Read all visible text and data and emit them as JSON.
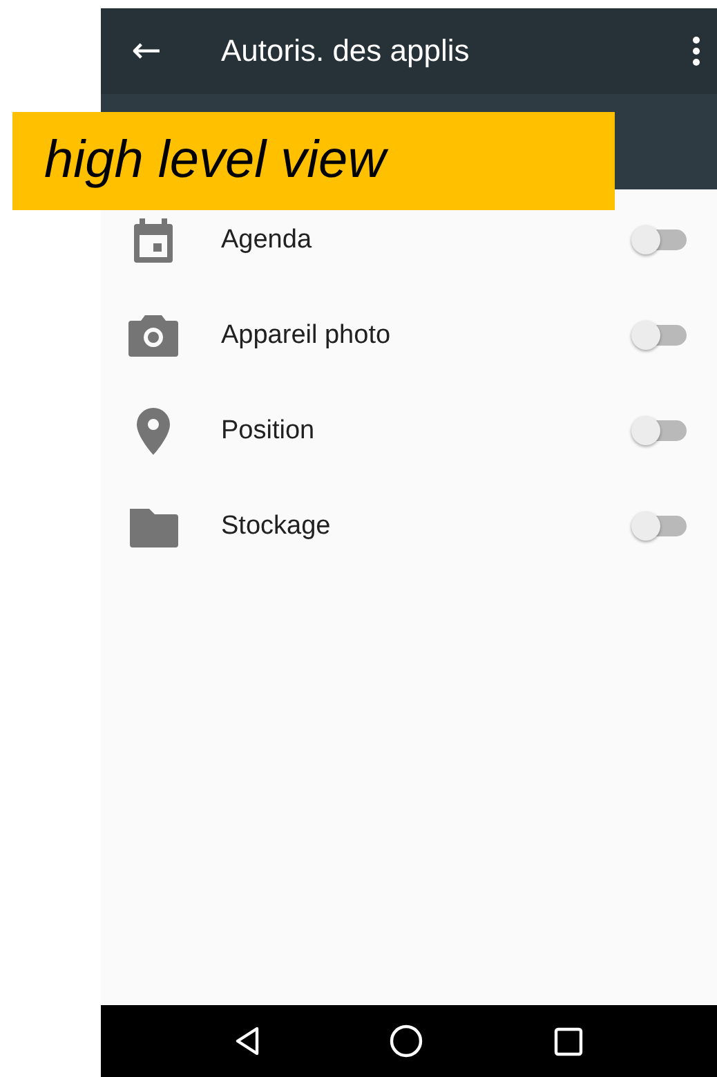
{
  "toolbar": {
    "back": "←",
    "title": "Autoris. des applis"
  },
  "annotation": "high level view",
  "permissions": [
    {
      "kind": "calendar",
      "label": "Agenda",
      "on": false
    },
    {
      "kind": "camera",
      "label": "Appareil photo",
      "on": false
    },
    {
      "kind": "location",
      "label": "Position",
      "on": false
    },
    {
      "kind": "storage",
      "label": "Stockage",
      "on": false
    }
  ]
}
